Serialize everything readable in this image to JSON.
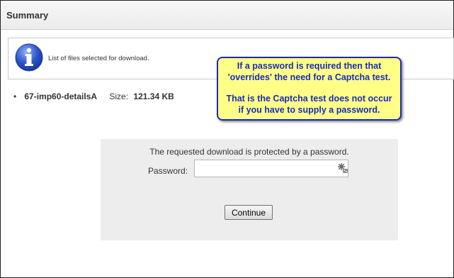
{
  "header": {
    "title": "Summary"
  },
  "info": {
    "text": "List of files selected for download."
  },
  "file": {
    "name": "67-imp60-detailsA",
    "size_label": "Size:",
    "size_value": "121.34 KB"
  },
  "callout": {
    "line1": "If a password is required then that",
    "line2": "'overrides' the need for a Captcha test.",
    "line3": "That is the Captcha test does not occur",
    "line4": "if you have to supply a password."
  },
  "password_panel": {
    "message": "The requested download is protected by a password.",
    "label": "Password:",
    "value": "",
    "continue_label": "Continue"
  },
  "icons": {
    "info": "info-icon",
    "key": "key-icon",
    "bullet": "bullet-icon"
  },
  "colors": {
    "callout_bg": "#ffff88",
    "callout_text": "#1a2bb8",
    "info_icon": "#2d55c8",
    "panel_bg": "#ededed"
  }
}
